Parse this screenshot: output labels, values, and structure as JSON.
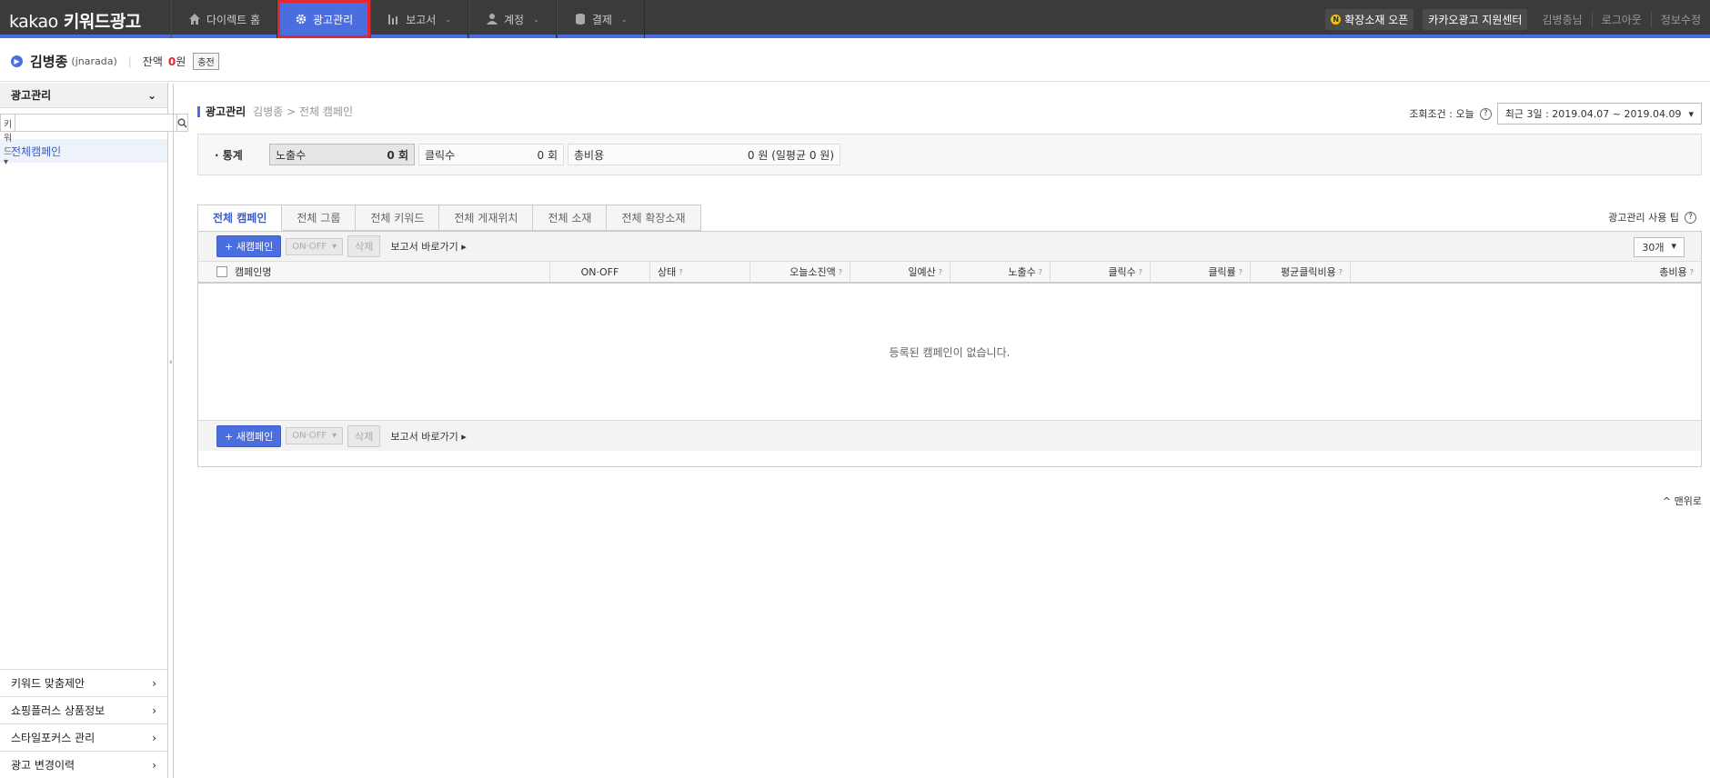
{
  "topnav": {
    "logo_brand": "kakao",
    "logo_product": "키워드광고",
    "menu": [
      {
        "label": "다이렉트 홈",
        "icon": "home-icon"
      },
      {
        "label": "광고관리",
        "icon": "gear-icon"
      },
      {
        "label": "보고서",
        "icon": "bar-chart-icon"
      },
      {
        "label": "계정",
        "icon": "user-icon"
      },
      {
        "label": "결제",
        "icon": "database-icon"
      }
    ],
    "new_badge": "N",
    "ext_open": "확장소재 오픈",
    "support": "카카오광고 지원센터",
    "user": "김병종님",
    "logout": "로그아웃",
    "edit_info": "정보수정"
  },
  "account": {
    "name": "김병종",
    "id": "(jnarada)",
    "balance_label": "잔액",
    "balance_num": "0",
    "balance_unit": "원",
    "charge": "충전"
  },
  "sidebar": {
    "title": "광고관리",
    "search_select": "키워드",
    "active_item": "전체캠페인",
    "bottom_items": [
      "키워드 맞춤제안",
      "쇼핑플러스 상품정보",
      "스타일포커스 관리",
      "광고 변경이력"
    ]
  },
  "main": {
    "crumb_title": "광고관리",
    "crumb_rest": "김병종 > 전체 캠페인",
    "cond_label": "조회조건 : 오늘",
    "date_range": "최근 3일 : 2019.04.07 ~ 2019.04.09",
    "stats_title": "· 통계",
    "stats": [
      {
        "label": "노출수",
        "value": "0 회"
      },
      {
        "label": "클릭수",
        "value": "0 회"
      },
      {
        "label": "총비용",
        "value": "0 원 (일평균 0 원)"
      }
    ],
    "tabs": [
      "전체 캠페인",
      "전체 그룹",
      "전체 키워드",
      "전체 게재위치",
      "전체 소재",
      "전체 확장소재"
    ],
    "tip": "광고관리 사용 팁",
    "new_campaign": "+ 새캠페인",
    "onoff": "ON·OFF",
    "delete": "삭제",
    "report_link": "보고서 바로가기",
    "perpage": "30개",
    "columns": [
      "캠페인명",
      "ON·OFF",
      "상태",
      "오늘소진액",
      "일예산",
      "노출수",
      "클릭수",
      "클릭률",
      "평균클릭비용",
      "총비용"
    ],
    "empty": "등록된 캠페인이 없습니다.",
    "to_top": "^ 맨위로"
  }
}
